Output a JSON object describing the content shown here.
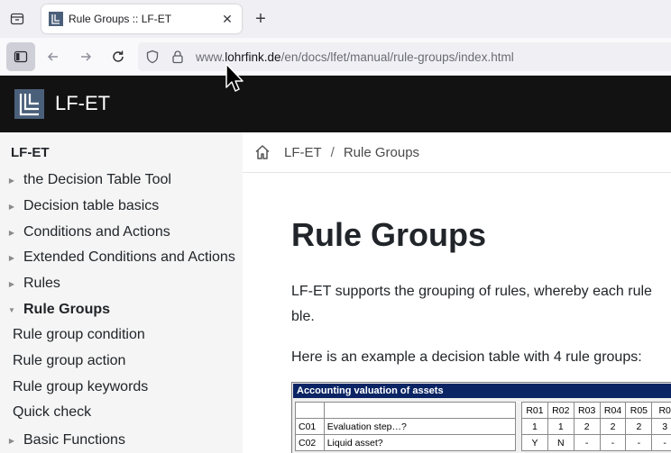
{
  "browser": {
    "tab_title": "Rule Groups :: LF-ET",
    "tab_close": "✕",
    "new_tab": "+",
    "url_prefix": "www.",
    "url_host": "lohrfink.de",
    "url_path": "/en/docs/lfet/manual/rule-groups/index.html"
  },
  "site": {
    "name": "LF-ET"
  },
  "leftnav": {
    "title": "LF-ET",
    "items": [
      {
        "label": "the Decision Table Tool",
        "arrow": "▶"
      },
      {
        "label": "Decision table basics",
        "arrow": "▶"
      },
      {
        "label": "Conditions and Actions",
        "arrow": "▶"
      },
      {
        "label": "Extended Conditions and Actions",
        "arrow": "▶"
      },
      {
        "label": "Rules",
        "arrow": "▶"
      },
      {
        "label": "Rule Groups",
        "arrow": "▼"
      },
      {
        "label": "Rule group condition"
      },
      {
        "label": "Rule group action"
      },
      {
        "label": "Rule group keywords"
      },
      {
        "label": "Quick check"
      },
      {
        "label": "Basic Functions",
        "arrow": "▶"
      }
    ]
  },
  "breadcrumb": {
    "root": "LF-ET",
    "sep": "/",
    "current": "Rule Groups"
  },
  "content": {
    "title": "Rule Groups",
    "para1_line1": "LF-ET supports the grouping of rules, whereby each rule",
    "para1_line2": "ble.",
    "para2": "Here is an example a decision table with 4 rule groups:"
  },
  "decision_table": {
    "title": "Accounting valuation of assets",
    "rule_headers": [
      "R01",
      "R02",
      "R03",
      "R04",
      "R05",
      "R0"
    ],
    "rows": [
      {
        "id": "C01",
        "text": "Evaluation step…?",
        "cells": [
          "1",
          "1",
          "2",
          "2",
          "2",
          "3"
        ]
      },
      {
        "id": "C02",
        "text": "Liquid asset?",
        "cells": [
          "Y",
          "N",
          "-",
          "-",
          "-",
          "-"
        ]
      }
    ]
  }
}
